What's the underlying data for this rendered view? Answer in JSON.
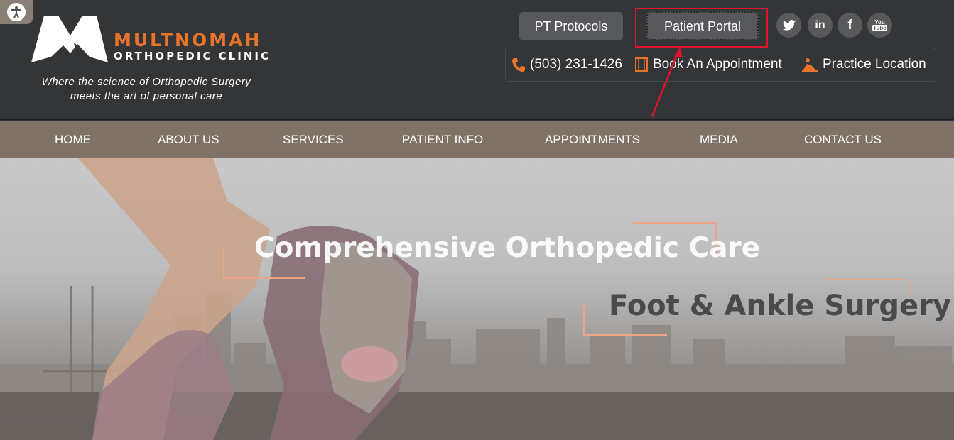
{
  "brand": {
    "name": "MULTNOMAH",
    "subtitle": "ORTHOPEDIC CLINIC",
    "tagline_line1": "Where the science of Orthopedic Surgery",
    "tagline_line2": "meets the art of personal care",
    "accent_color": "#e8742a"
  },
  "top_buttons": {
    "pt_protocols": "PT Protocols",
    "patient_portal": "Patient Portal"
  },
  "social": [
    {
      "icon": "twitter-icon",
      "glyph": "🐦"
    },
    {
      "icon": "linkedin-icon",
      "glyph": "in"
    },
    {
      "icon": "facebook-icon",
      "glyph": "f"
    },
    {
      "icon": "youtube-icon",
      "glyph": "You\nTube"
    }
  ],
  "contact": {
    "phone": "(503) 231-1426",
    "book": "Book An Appointment",
    "location": "Practice Location"
  },
  "nav": [
    "HOME",
    "ABOUT US",
    "SERVICES",
    "PATIENT INFO",
    "APPOINTMENTS",
    "MEDIA",
    "CONTACT US"
  ],
  "hero": {
    "title": "Comprehensive Orthopedic Care",
    "subtitle": "Foot & Ankle Surgery"
  },
  "annotation": {
    "highlight_color": "#e3122d"
  }
}
